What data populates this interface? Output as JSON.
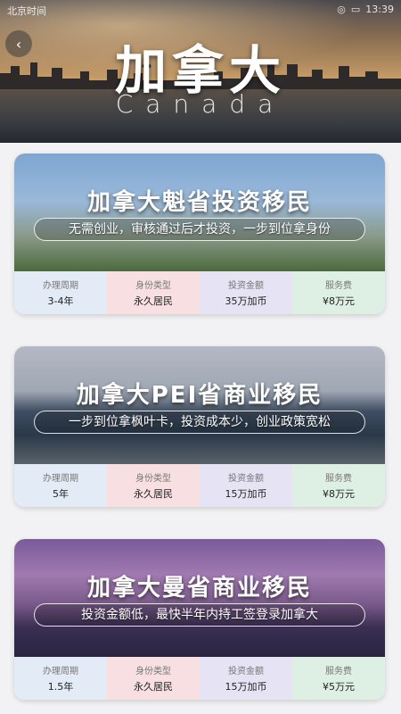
{
  "status": {
    "left": "北京时间",
    "right": "13:39"
  },
  "hero": {
    "title": "加拿大",
    "subtitle": "Canada"
  },
  "cards": [
    {
      "title": "加拿大魁省投资移民",
      "tag": "无需创业，审核通过后才投资，一步到位拿身份",
      "stats": [
        {
          "label": "办理周期",
          "value": "3-4年"
        },
        {
          "label": "身份类型",
          "value": "永久居民"
        },
        {
          "label": "投资金额",
          "value": "35万加币"
        },
        {
          "label": "服务费",
          "value": "¥8万元"
        }
      ]
    },
    {
      "title": "加拿大PEI省商业移民",
      "tag": "一步到位拿枫叶卡，投资成本少，创业政策宽松",
      "stats": [
        {
          "label": "办理周期",
          "value": "5年"
        },
        {
          "label": "身份类型",
          "value": "永久居民"
        },
        {
          "label": "投资金额",
          "value": "15万加币"
        },
        {
          "label": "服务费",
          "value": "¥8万元"
        }
      ]
    },
    {
      "title": "加拿大曼省商业移民",
      "tag": "投资金额低，最快半年内持工签登录加拿大",
      "stats": [
        {
          "label": "办理周期",
          "value": "1.5年"
        },
        {
          "label": "身份类型",
          "value": "永久居民"
        },
        {
          "label": "投资金额",
          "value": "15万加币"
        },
        {
          "label": "服务费",
          "value": "¥5万元"
        }
      ]
    }
  ]
}
